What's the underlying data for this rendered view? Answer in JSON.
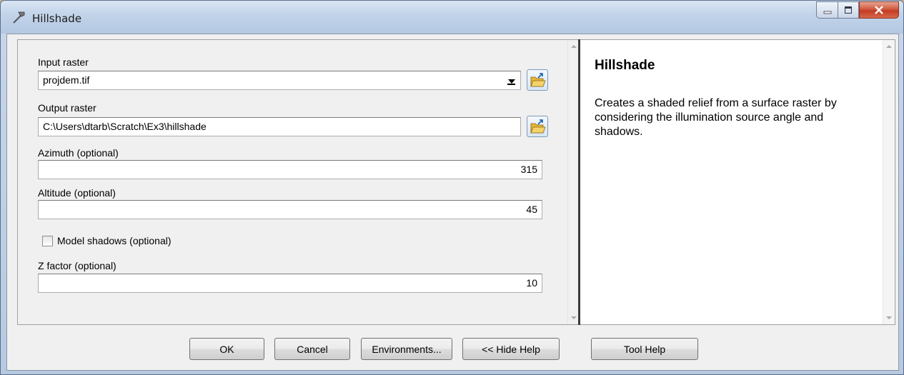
{
  "window": {
    "title": "Hillshade",
    "controls": {
      "minimize": "minimize-icon",
      "maximize": "maximize-icon",
      "close": "close-icon"
    }
  },
  "form": {
    "input_raster": {
      "label": "Input raster",
      "value": "projdem.tif"
    },
    "output_raster": {
      "label": "Output raster",
      "value": "C:\\Users\\dtarb\\Scratch\\Ex3\\hillshade"
    },
    "azimuth": {
      "label": "Azimuth (optional)",
      "value": "315"
    },
    "altitude": {
      "label": "Altitude (optional)",
      "value": "45"
    },
    "model_shadows": {
      "label": "Model shadows (optional)",
      "checked": false
    },
    "z_factor": {
      "label": "Z factor (optional)",
      "value": "10"
    }
  },
  "help": {
    "title": "Hillshade",
    "description": "Creates a shaded relief from a surface raster by considering the illumination source angle and shadows."
  },
  "buttons": {
    "ok": "OK",
    "cancel": "Cancel",
    "environments": "Environments...",
    "hide_help": "<< Hide Help",
    "tool_help": "Tool Help"
  },
  "colors": {
    "title_bar": "#c3d4ea",
    "close_button": "#c23b22",
    "splitter": "#3b3b3b",
    "folder": "#e8b63a"
  }
}
